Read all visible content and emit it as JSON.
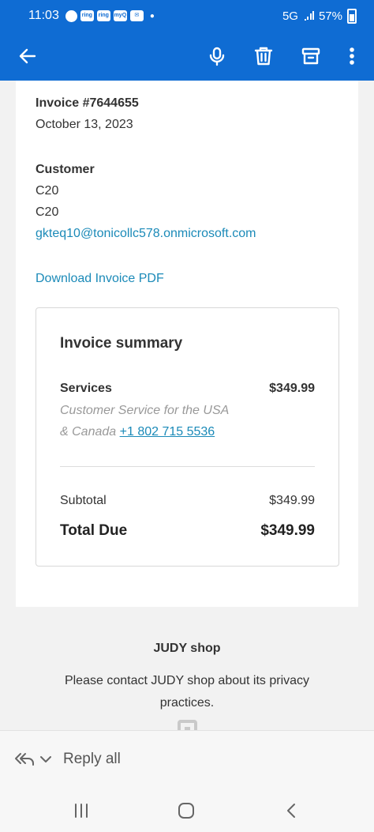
{
  "status_bar": {
    "time": "11:03",
    "network": "5G",
    "battery": "57%",
    "notification_icons": [
      "message-icon",
      "ring-icon",
      "ring-icon",
      "myq-icon",
      "outlook-icon"
    ],
    "notif_labels": [
      "ring",
      "ring",
      "myQ"
    ]
  },
  "app_bar": {
    "icons": [
      "back-arrow-icon",
      "microphone-icon",
      "trash-icon",
      "archive-icon",
      "more-vertical-icon"
    ],
    "accent": "#0f6cd3"
  },
  "invoice": {
    "number": "Invoice #7644655",
    "date": "October 13, 2023",
    "customer_heading": "Customer",
    "customer_line1": "C20",
    "customer_line2": "C20",
    "customer_email": "gkteq10@tonicollc578.onmicrosoft.com",
    "download_link": "Download Invoice PDF",
    "link_color": "#1b8ab8"
  },
  "summary": {
    "title": "Invoice summary",
    "service_name": "Services",
    "service_price": "$349.99",
    "service_desc_line1": "Customer Service for the USA",
    "service_desc_line2": "& Canada",
    "service_phone": "+1 802 715 5536",
    "subtotal_label": "Subtotal",
    "subtotal_value": "$349.99",
    "total_label": "Total Due",
    "total_value": "$349.99"
  },
  "footer": {
    "shop_name": "JUDY shop",
    "privacy_text": "Please contact JUDY shop about its privacy practices."
  },
  "reply_bar": {
    "label": "Reply all"
  },
  "nav_bar": {
    "icons": [
      "recents-icon",
      "home-icon",
      "back-icon"
    ]
  }
}
